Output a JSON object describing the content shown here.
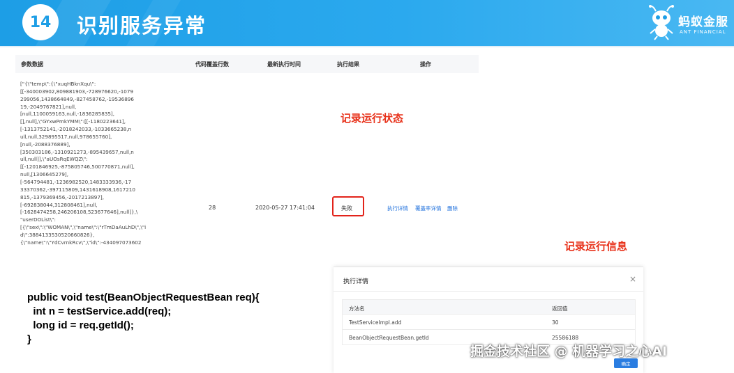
{
  "slide": {
    "number": "14",
    "title": "识别服务异常",
    "logo_cn": "蚂蚁金服",
    "logo_en": "ANT FINANCIAL"
  },
  "table": {
    "headers": [
      "参数数据",
      "代码覆盖行数",
      "最新执行时间",
      "执行结果",
      "操作"
    ],
    "param_data": "[\"{\\\"temp\\\":{\\\"xuqHBknXqu\\\":\n[[-340003902,809881903,-728976620,-1079\n299056,1438664849,-827458762,-19536896\n19,-2049767821],null,\n[null,1100059163,null,-1836285835],\n[],null],\\\"GYxwPmkYMM\\\":[[-1180223641],\n[-1313752141,-2018242033,-1033665238,n\null,null,329895517,null,978655760],\n[null,-2088376889],\n[350303186,-1310921273,-895439657,null,n\null,null]],\\\"aUOsRqEWQZ\\\":\n[[-1201846925,-875805746,500770871,null],\nnull,[1306645279],\n[-564794481,-1236982520,1483333936,-17\n33370362,-397115809,1431618908,1617210\n815,-1379369456,-2017213897],\n[-692838044,312808461],null,\n[-1628474258,246206108,523677646],null]},\\\n\"userDOList\\\":\n[{\\\"sex\\\":\\\"WOMAN\\\",\\\"name\\\":\\\"rTmDaAuLhD\\\",\\\"i\nd\\\":3884133530520660826},\n{\\\"name\\\":\\\"YdCvrnkRcv\\\",\\\"id\\\":-434097073602",
    "coverage": "28",
    "time": "2020-05-27 17:41:04",
    "result": "失败",
    "ops": [
      "执行详情",
      "覆盖率详情",
      "删除"
    ]
  },
  "annotations": {
    "state": "记录运行状态",
    "info": "记录运行信息"
  },
  "code": "public void test(BeanObjectRequestBean req){\n  int n = testService.add(req);\n  long id = req.getId();\n}",
  "modal": {
    "title": "执行详情",
    "close": "×",
    "headers": [
      "方法名",
      "返回值"
    ],
    "rows": [
      {
        "method": "TestServiceImpl.add",
        "value": "30"
      },
      {
        "method": "BeanObjectRequestBean.getId",
        "value": "25586188"
      }
    ],
    "ok": "确定"
  },
  "watermark": "掘金技术社区 @ 机器学习之心AI",
  "colors": {
    "banner": "#1d9ee6",
    "annotation": "#e8321b",
    "link": "#1d6fdc",
    "button": "#2a7de1"
  }
}
